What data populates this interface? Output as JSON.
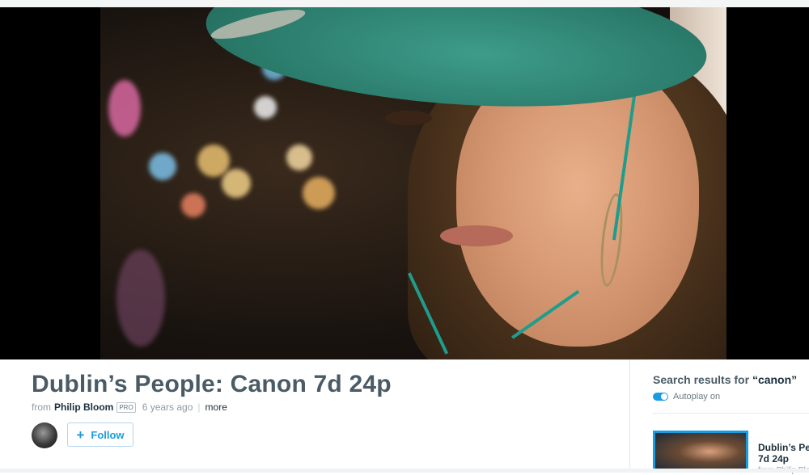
{
  "video": {
    "title": "Dublin’s People: Canon 7d 24p",
    "from_label": "from",
    "author": "Philip Bloom",
    "badge": "PRO",
    "age": "6 years ago",
    "separator": "|",
    "more_label": "more"
  },
  "follow": {
    "icon": "plus-icon",
    "plus_glyph": "+",
    "label": "Follow"
  },
  "sidebar": {
    "heading_prefix": "Search results for ",
    "query": "“canon”",
    "autoplay_label": "Autoplay on",
    "recommendation": {
      "title_line1": "Dublin’s Peo",
      "title_line2": "7d 24p",
      "from": "from Philip Blo"
    }
  },
  "colors": {
    "accent": "#1a9de0",
    "title_text": "#4a5b66",
    "author_text": "#1a2e3b"
  }
}
